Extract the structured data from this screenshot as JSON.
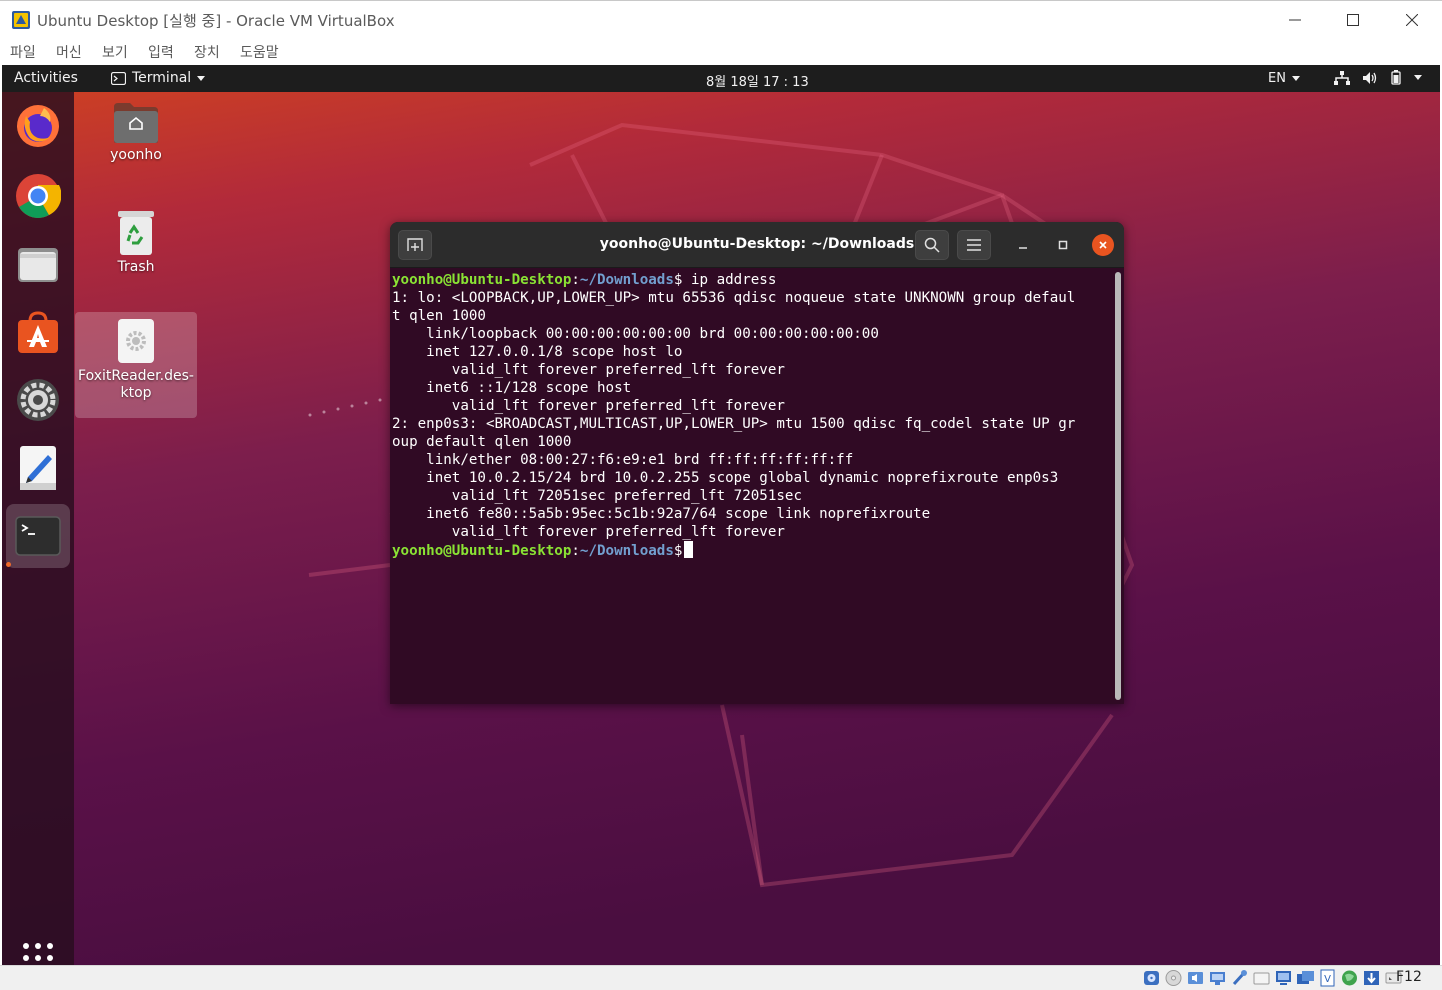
{
  "window": {
    "title": "Ubuntu Desktop [실행 중] - Oracle VM VirtualBox",
    "menu": [
      "파일",
      "머신",
      "보기",
      "입력",
      "장치",
      "도움말"
    ]
  },
  "topbar": {
    "activities": "Activities",
    "app_name": "Terminal",
    "clock": "8월 18일  17 : 13",
    "language": "EN",
    "tray_icons": [
      "network-icon",
      "volume-icon",
      "battery-icon",
      "system-menu-caret"
    ]
  },
  "dock": {
    "apps": [
      "firefox-icon",
      "chrome-icon",
      "files-icon",
      "ubuntu-software-icon",
      "settings-icon",
      "text-editor-icon",
      "terminal-icon"
    ],
    "active": "terminal-icon",
    "show_apps": "show-applications-icon"
  },
  "desktop": {
    "icons": [
      {
        "label": "yoonho"
      },
      {
        "label": "Trash"
      },
      {
        "label": "FoxitReader.des-ktop"
      }
    ]
  },
  "terminal": {
    "title": "yoonho@Ubuntu-Desktop: ~/Downloads",
    "prompt_user": "yoonho@Ubuntu-Desktop",
    "prompt_sep": ":",
    "prompt_path": "~/Downloads",
    "prompt_end": "$",
    "command": " ip address",
    "output": [
      "1: lo: <LOOPBACK,UP,LOWER_UP> mtu 65536 qdisc noqueue state UNKNOWN group defaul",
      "t qlen 1000",
      "    link/loopback 00:00:00:00:00:00 brd 00:00:00:00:00:00",
      "    inet 127.0.0.1/8 scope host lo",
      "       valid_lft forever preferred_lft forever",
      "    inet6 ::1/128 scope host",
      "       valid_lft forever preferred_lft forever",
      "2: enp0s3: <BROADCAST,MULTICAST,UP,LOWER_UP> mtu 1500 qdisc fq_codel state UP gr",
      "oup default qlen 1000",
      "    link/ether 08:00:27:f6:e9:e1 brd ff:ff:ff:ff:ff:ff",
      "    inet 10.0.2.15/24 brd 10.0.2.255 scope global dynamic noprefixroute enp0s3",
      "       valid_lft 72051sec preferred_lft 72051sec",
      "    inet6 fe80::5a5b:95ec:5c1b:92a7/64 scope link noprefixroute",
      "       valid_lft forever preferred_lft forever"
    ]
  },
  "statusbar": {
    "host_key": "F12",
    "icons": [
      "hard-disk-icon",
      "optical-drive-icon",
      "audio-icon",
      "network-adapter-icon",
      "usb-icon",
      "shared-folders-icon",
      "display-icon",
      "video-capture-icon",
      "recording-icon",
      "cpu-icon",
      "mouse-integration-icon",
      "keyboard-capture-icon"
    ]
  },
  "colors": {
    "ubuntu_orange": "#e95420",
    "terminal_bg": "#300a24",
    "prompt_user": "#8ae234",
    "prompt_path": "#729fcf"
  }
}
